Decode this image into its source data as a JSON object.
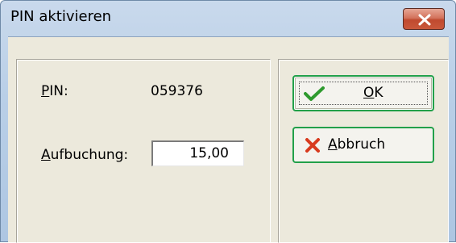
{
  "window": {
    "title": "PIN aktivieren"
  },
  "form": {
    "pin_label_accel": "P",
    "pin_label_rest": "IN:",
    "pin_value": "059376",
    "amount_label_accel": "A",
    "amount_label_rest": "ufbuchung:",
    "amount_value": "15,00"
  },
  "buttons": {
    "ok_accel": "O",
    "ok_rest": "K",
    "cancel_accel": "A",
    "cancel_rest": "bbruch"
  },
  "colors": {
    "ok_icon": "#2e9a2e",
    "cancel_icon": "#d83a1e",
    "button_border": "#22a04a"
  },
  "icons": {
    "ok": "checkmark-icon",
    "cancel": "x-icon",
    "close": "close-icon"
  }
}
